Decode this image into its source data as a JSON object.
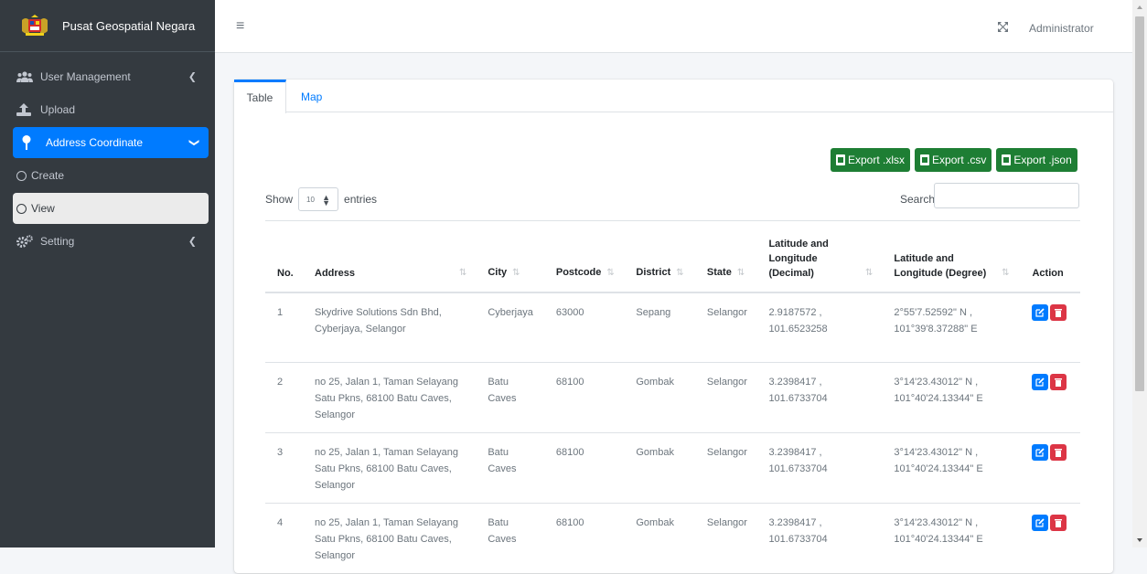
{
  "brand": {
    "name": "Pusat Geospatial Negara"
  },
  "sidebar": {
    "items": [
      {
        "label": "User Management",
        "icon": "users-icon"
      },
      {
        "label": "Upload",
        "icon": "upload-icon"
      },
      {
        "label": "Address Coordinate",
        "icon": "map-pin-icon"
      },
      {
        "label": "Create",
        "icon": "circle-icon"
      },
      {
        "label": "View",
        "icon": "circle-icon"
      },
      {
        "label": "Setting",
        "icon": "gears-icon"
      }
    ]
  },
  "topbar": {
    "user": "Administrator"
  },
  "tabs": {
    "table": "Table",
    "map": "Map"
  },
  "exports": {
    "xlsx": "Export .xlsx",
    "csv": "Export .csv",
    "json": "Export .json"
  },
  "controls": {
    "show": "Show",
    "entries_value": "10",
    "entries": "entries",
    "search": "Search:"
  },
  "table": {
    "headers": {
      "no": "No.",
      "address": "Address",
      "city": "City",
      "postcode": "Postcode",
      "district": "District",
      "state": "State",
      "latlon_dec": "Latitude and Longitude (Decimal)",
      "latlon_deg": "Latitude and Longitude (Degree)",
      "action": "Action"
    },
    "rows": [
      {
        "no": "1",
        "address": "Skydrive Solutions Sdn Bhd, Cyberjaya, Selangor",
        "city": "Cyberjaya",
        "postcode": "63000",
        "district": "Sepang",
        "state": "Selangor",
        "dec": "2.9187572 , 101.6523258",
        "deg": "2°55'7.52592\" N , 101°39'8.37288\" E"
      },
      {
        "no": "2",
        "address": "no 25, Jalan 1, Taman Selayang Satu Pkns, 68100 Batu Caves, Selangor",
        "city": "Batu Caves",
        "postcode": "68100",
        "district": "Gombak",
        "state": "Selangor",
        "dec": "3.2398417 , 101.6733704",
        "deg": "3°14'23.43012\" N , 101°40'24.13344\" E"
      },
      {
        "no": "3",
        "address": "no 25, Jalan 1, Taman Selayang Satu Pkns, 68100 Batu Caves, Selangor",
        "city": "Batu Caves",
        "postcode": "68100",
        "district": "Gombak",
        "state": "Selangor",
        "dec": "3.2398417 , 101.6733704",
        "deg": "3°14'23.43012\" N , 101°40'24.13344\" E"
      },
      {
        "no": "4",
        "address": "no 25, Jalan 1, Taman Selayang Satu Pkns, 68100 Batu Caves, Selangor",
        "city": "Batu Caves",
        "postcode": "68100",
        "district": "Gombak",
        "state": "Selangor",
        "dec": "3.2398417 , 101.6733704",
        "deg": "3°14'23.43012\" N , 101°40'24.13344\" E"
      }
    ]
  },
  "colors": {
    "primary": "#007bff",
    "sidebar": "#343a40",
    "export": "#1e7e34",
    "danger": "#dc3545"
  }
}
